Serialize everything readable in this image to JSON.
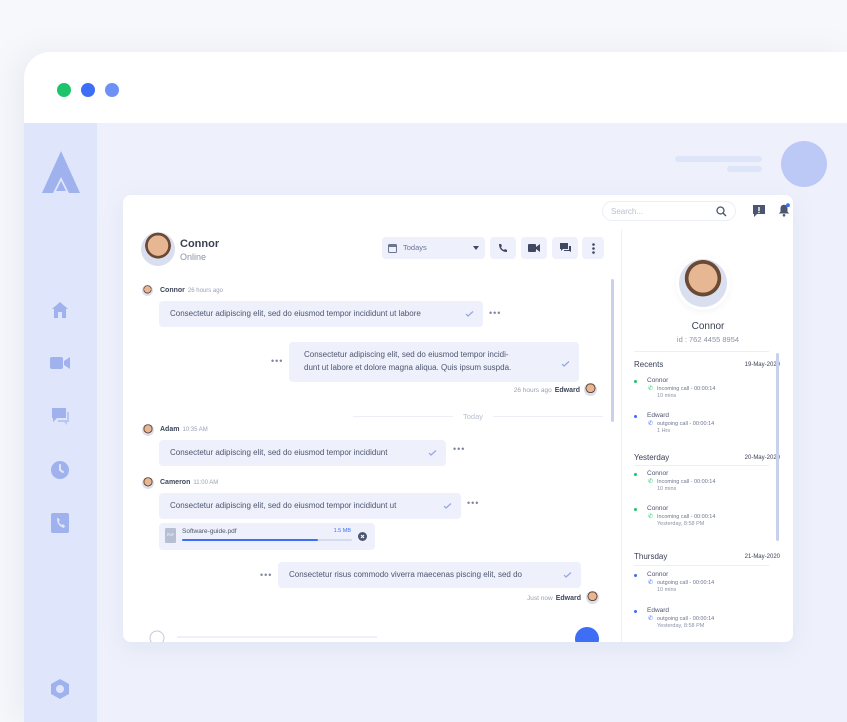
{
  "window": {
    "dots": [
      "#1ec46b",
      "#3e6ef5",
      "#6e91f5"
    ]
  },
  "topbar": {
    "search_placeholder": "Search..."
  },
  "chat": {
    "contact": {
      "name": "Connor",
      "status": "Online"
    },
    "filter_label": "Todays",
    "messages": [
      {
        "sender": "Connor",
        "time": "26 hours ago",
        "text": "Consectetur adipiscing elit, sed do eiusmod tempor incididunt ut labore"
      },
      {
        "text_line1": "Consectetur adipiscing elit, sed do eiusmod tempor incidi-",
        "text_line2": "dunt ut labore et dolore magna aliqua. Quis ipsum suspda.",
        "time": "26 hours ago",
        "sender": "Edward"
      },
      {
        "sender": "Adam",
        "time": "10:35 AM",
        "text": "Consectetur adipiscing elit, sed do eiusmod tempor incididunt"
      },
      {
        "sender": "Cameron",
        "time": "11:00 AM",
        "text": "Consectetur adipiscing elit, sed do eiusmod tempor incididunt ut"
      },
      {
        "text": "Consectetur risus commodo viverra maecenas piscing elit, sed do",
        "time": "Just now",
        "sender": "Edward"
      }
    ],
    "divider": "Today",
    "attachment": {
      "name": "Software-guide.pdf",
      "size": "1.5 MB",
      "progress": 0.8,
      "type_label": "PDF"
    }
  },
  "profile": {
    "name": "Connor",
    "id": "id : 762 4455 8954"
  },
  "sections": [
    {
      "title": "Recents",
      "date": "19-May-2020",
      "entries": [
        {
          "name": "Connor",
          "call": "Incoming call - 00:00:14",
          "duration": "10 mins",
          "color": "#1ec46b"
        },
        {
          "name": "Edward",
          "call": "outgoing call - 00:00:14",
          "duration": "1 Hrs",
          "color": "#3e6ef5"
        }
      ]
    },
    {
      "title": "Yesterday",
      "date": "20-May-2020",
      "entries": [
        {
          "name": "Connor",
          "call": "Incoming call - 00:00:14",
          "duration": "10 mins",
          "color": "#1ec46b"
        },
        {
          "name": "Connor",
          "call": "Incoming call - 00:00:14",
          "duration": "Yesterday, 8:58 PM",
          "color": "#1ec46b"
        }
      ]
    },
    {
      "title": "Thursday",
      "date": "21-May-2020",
      "entries": [
        {
          "name": "Connor",
          "call": "outgoing call - 00:00:14",
          "duration": "10 mins",
          "color": "#3e6ef5"
        },
        {
          "name": "Edward",
          "call": "outgoing call - 00:00:14",
          "duration": "Yesterday, 8:58 PM",
          "color": "#3e6ef5"
        }
      ]
    }
  ],
  "colors": {
    "accent": "#3e6ef5",
    "online": "#1ec46b",
    "rail": "#dfe5fa",
    "bubble": "#eef1fb"
  }
}
